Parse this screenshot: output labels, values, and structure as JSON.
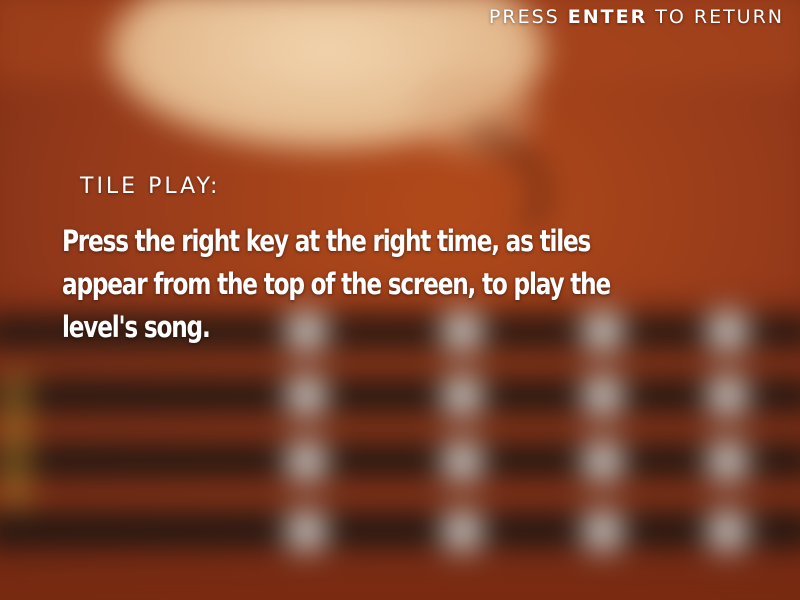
{
  "header": {
    "hint_prefix": "PRESS",
    "hint_key": "ENTER",
    "hint_suffix": "TO RETURN"
  },
  "instructions": {
    "heading": "TILE PLAY:",
    "body": "Press the right key at the right time, as tiles appear from the top of the screen, to play the level's song."
  },
  "colors": {
    "text": "#ffffff",
    "background_wood": "#8a3412",
    "background_light": "#e9c8a0",
    "strings_dark": "#1b1512"
  }
}
